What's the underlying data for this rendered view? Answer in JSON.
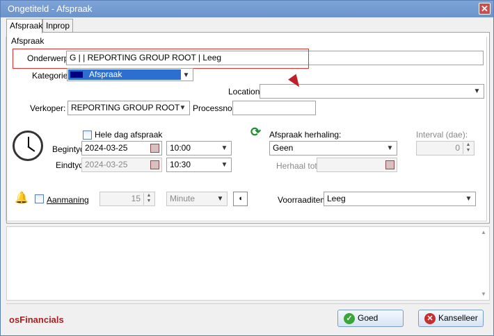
{
  "window": {
    "title": "Ongetiteld - Afspraak",
    "close_label": "✕"
  },
  "tabs": [
    {
      "label": "Afspraak"
    },
    {
      "label": "Inprop"
    }
  ],
  "group": {
    "title": "Afspraak"
  },
  "fields": {
    "onderwerp": {
      "label": "Onderwerp",
      "value": "G |  | REPORTING GROUP ROOT | Leeg"
    },
    "kategorie": {
      "label": "Kategorie",
      "value": "Afspraak",
      "color": "#000080"
    },
    "location": {
      "label": "Location",
      "value": ""
    },
    "verkoper": {
      "label": "Verkoper:",
      "value": "REPORTING GROUP ROOT"
    },
    "processno": {
      "label": "Processno:",
      "value": ""
    }
  },
  "schedule": {
    "hele_dag_label": "Hele dag afspraak",
    "begintyd_label": "Begintyd",
    "begintyd_date": "2024-03-25",
    "begintyd_time": "10:00",
    "eindtyd_label": "Eindtyd",
    "eindtyd_date": "2024-03-25",
    "eindtyd_time": "10:30"
  },
  "recurrence": {
    "label": "Afspraak herhaling:",
    "value": "Geen",
    "herhaal_label": "Herhaal tot:",
    "herhaal_value": "",
    "interval_label": "Interval (dae):",
    "interval_value": "0"
  },
  "reminder": {
    "label": "Aanmaning",
    "amount": "15",
    "unit": "Minute",
    "voorraad_label": "Voorraaditem",
    "voorraad_value": "Leeg"
  },
  "footer": {
    "brand": "osFinancials",
    "ok_label": "Goed",
    "cancel_label": "Kanselleer"
  },
  "icons": {
    "close": "close-icon",
    "dropdown": "chevron-down-icon",
    "calendar": "calendar-icon",
    "clock": "clock-icon",
    "refresh": "refresh-icon",
    "bell": "bell-icon",
    "sound": "speaker-icon",
    "check": "check-icon",
    "cancel": "cancel-icon"
  }
}
